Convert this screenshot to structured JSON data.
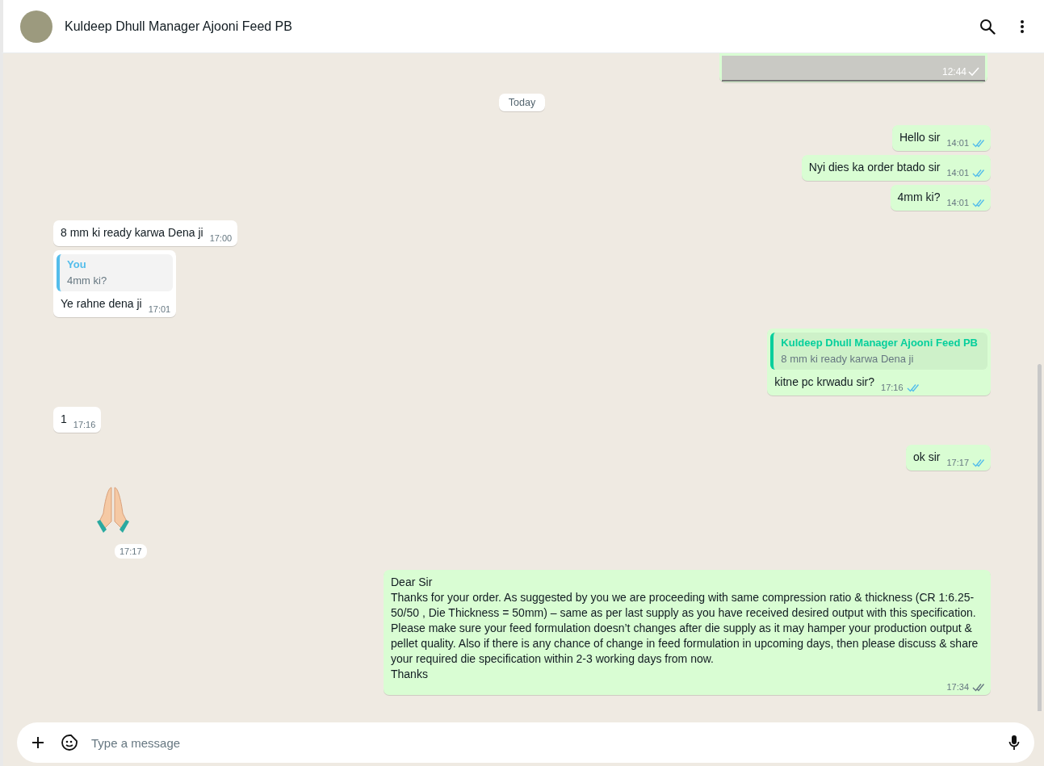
{
  "header": {
    "contact_name": "Kuldeep Dhull Manager Ajooni Feed PB"
  },
  "messages": [
    {
      "kind": "image",
      "outgoing": true,
      "time": "12:44"
    },
    {
      "kind": "date",
      "text": "Today"
    },
    {
      "kind": "text",
      "outgoing": true,
      "text": "Hello sir",
      "time": "14:01",
      "read": true
    },
    {
      "kind": "text",
      "outgoing": true,
      "text": "Nyi dies ka order btado sir",
      "time": "14:01",
      "read": true
    },
    {
      "kind": "text",
      "outgoing": true,
      "text": "4mm ki?",
      "time": "14:01",
      "read": true
    },
    {
      "kind": "text",
      "outgoing": false,
      "text": "8 mm ki ready karwa Dena ji",
      "time": "17:00"
    },
    {
      "kind": "reply",
      "outgoing": false,
      "quote": {
        "author": "You",
        "text": "4mm ki?",
        "color": "#53bdeb"
      },
      "text": "Ye rahne dena ji",
      "time": "17:01"
    },
    {
      "kind": "reply",
      "outgoing": true,
      "quote": {
        "author": "Kuldeep Dhull Manager Ajooni Feed PB",
        "text": "8 mm ki ready karwa Dena ji",
        "color": "#06cf9c"
      },
      "text": "kitne pc krwadu sir?",
      "time": "17:16",
      "read": true
    },
    {
      "kind": "text",
      "outgoing": false,
      "text": "1",
      "time": "17:16"
    },
    {
      "kind": "text",
      "outgoing": true,
      "text": "ok sir",
      "time": "17:17",
      "read": true
    },
    {
      "kind": "sticker",
      "outgoing": false,
      "time": "17:17"
    },
    {
      "kind": "long",
      "outgoing": true,
      "text": "Dear Sir\nThanks for your order. As suggested by you we are proceeding with same compression ratio & thickness (CR 1:6.25-50/50 , Die Thickness = 50mm) – same as per last supply as you have received desired output with this specification. Please make sure your feed formulation doesn’t changes after die supply as it may hamper your production output & pellet quality. Also if there is any chance of change in feed formulation in upcoming days, then please discuss & share your required die specification within 2-3 working days from now.\nThanks",
      "time": "17:34",
      "read": false
    }
  ],
  "composer": {
    "placeholder": "Type a message"
  }
}
